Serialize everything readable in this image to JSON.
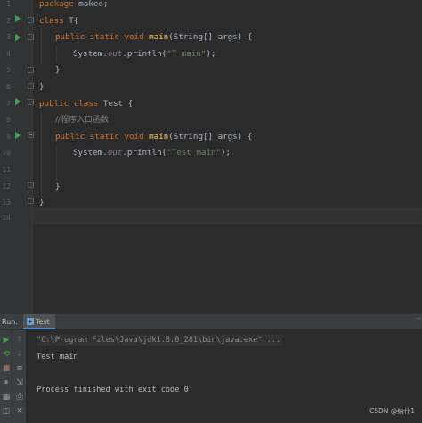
{
  "editor": {
    "line_numbers": [
      "1",
      "2",
      "3",
      "4",
      "5",
      "6",
      "7",
      "8",
      "9",
      "10",
      "11",
      "12",
      "13",
      "14"
    ],
    "lines": {
      "l1_kw": "package",
      "l1_rest": " makee;",
      "l2_kw": "class",
      "l2_rest": " T{",
      "l3_kw": "public static void",
      "l3_fn": "main",
      "l3_rest": "(String[] args) {",
      "l4_a": "System.",
      "l4_field": "out",
      "l4_b": ".println(",
      "l4_str": "\"T main\"",
      "l4_c": ");",
      "l5": "}",
      "l6": "}",
      "l7_kw": "public class",
      "l7_rest": " Test {",
      "l8_cmt": "//程序入口函数",
      "l9_kw": "public static void",
      "l9_fn": "main",
      "l9_rest": "(String[] args) {",
      "l10_a": "System.",
      "l10_field": "out",
      "l10_b": ".println(",
      "l10_str": "\"Test main\"",
      "l10_c": ");",
      "l12": "}",
      "l13": "}"
    }
  },
  "tool_window": {
    "run_label": "Run:",
    "tab_label": "Test",
    "close_glyph": "–",
    "console": {
      "command": "\"C:\\Program Files\\Java\\jdk1.8.0_281\\bin\\java.exe\" ...",
      "output": "Test main",
      "exit": "Process finished with exit code 0"
    }
  },
  "watermark": "CSDN @纳什1",
  "icons": [
    "run-icon",
    "rerun-icon",
    "stop-icon",
    "pause-icon",
    "layout-icon",
    "dump-icon",
    "print-icon",
    "pin-icon",
    "up-arrow-icon",
    "down-arrow-icon",
    "wrap-icon",
    "scroll-end-icon",
    "trash-icon"
  ],
  "colors": {
    "keyword": "#cc7832",
    "function": "#ffc66d",
    "string": "#6a8759",
    "field": "#9876aa",
    "comment": "#808080",
    "run_green": "#499c54"
  }
}
